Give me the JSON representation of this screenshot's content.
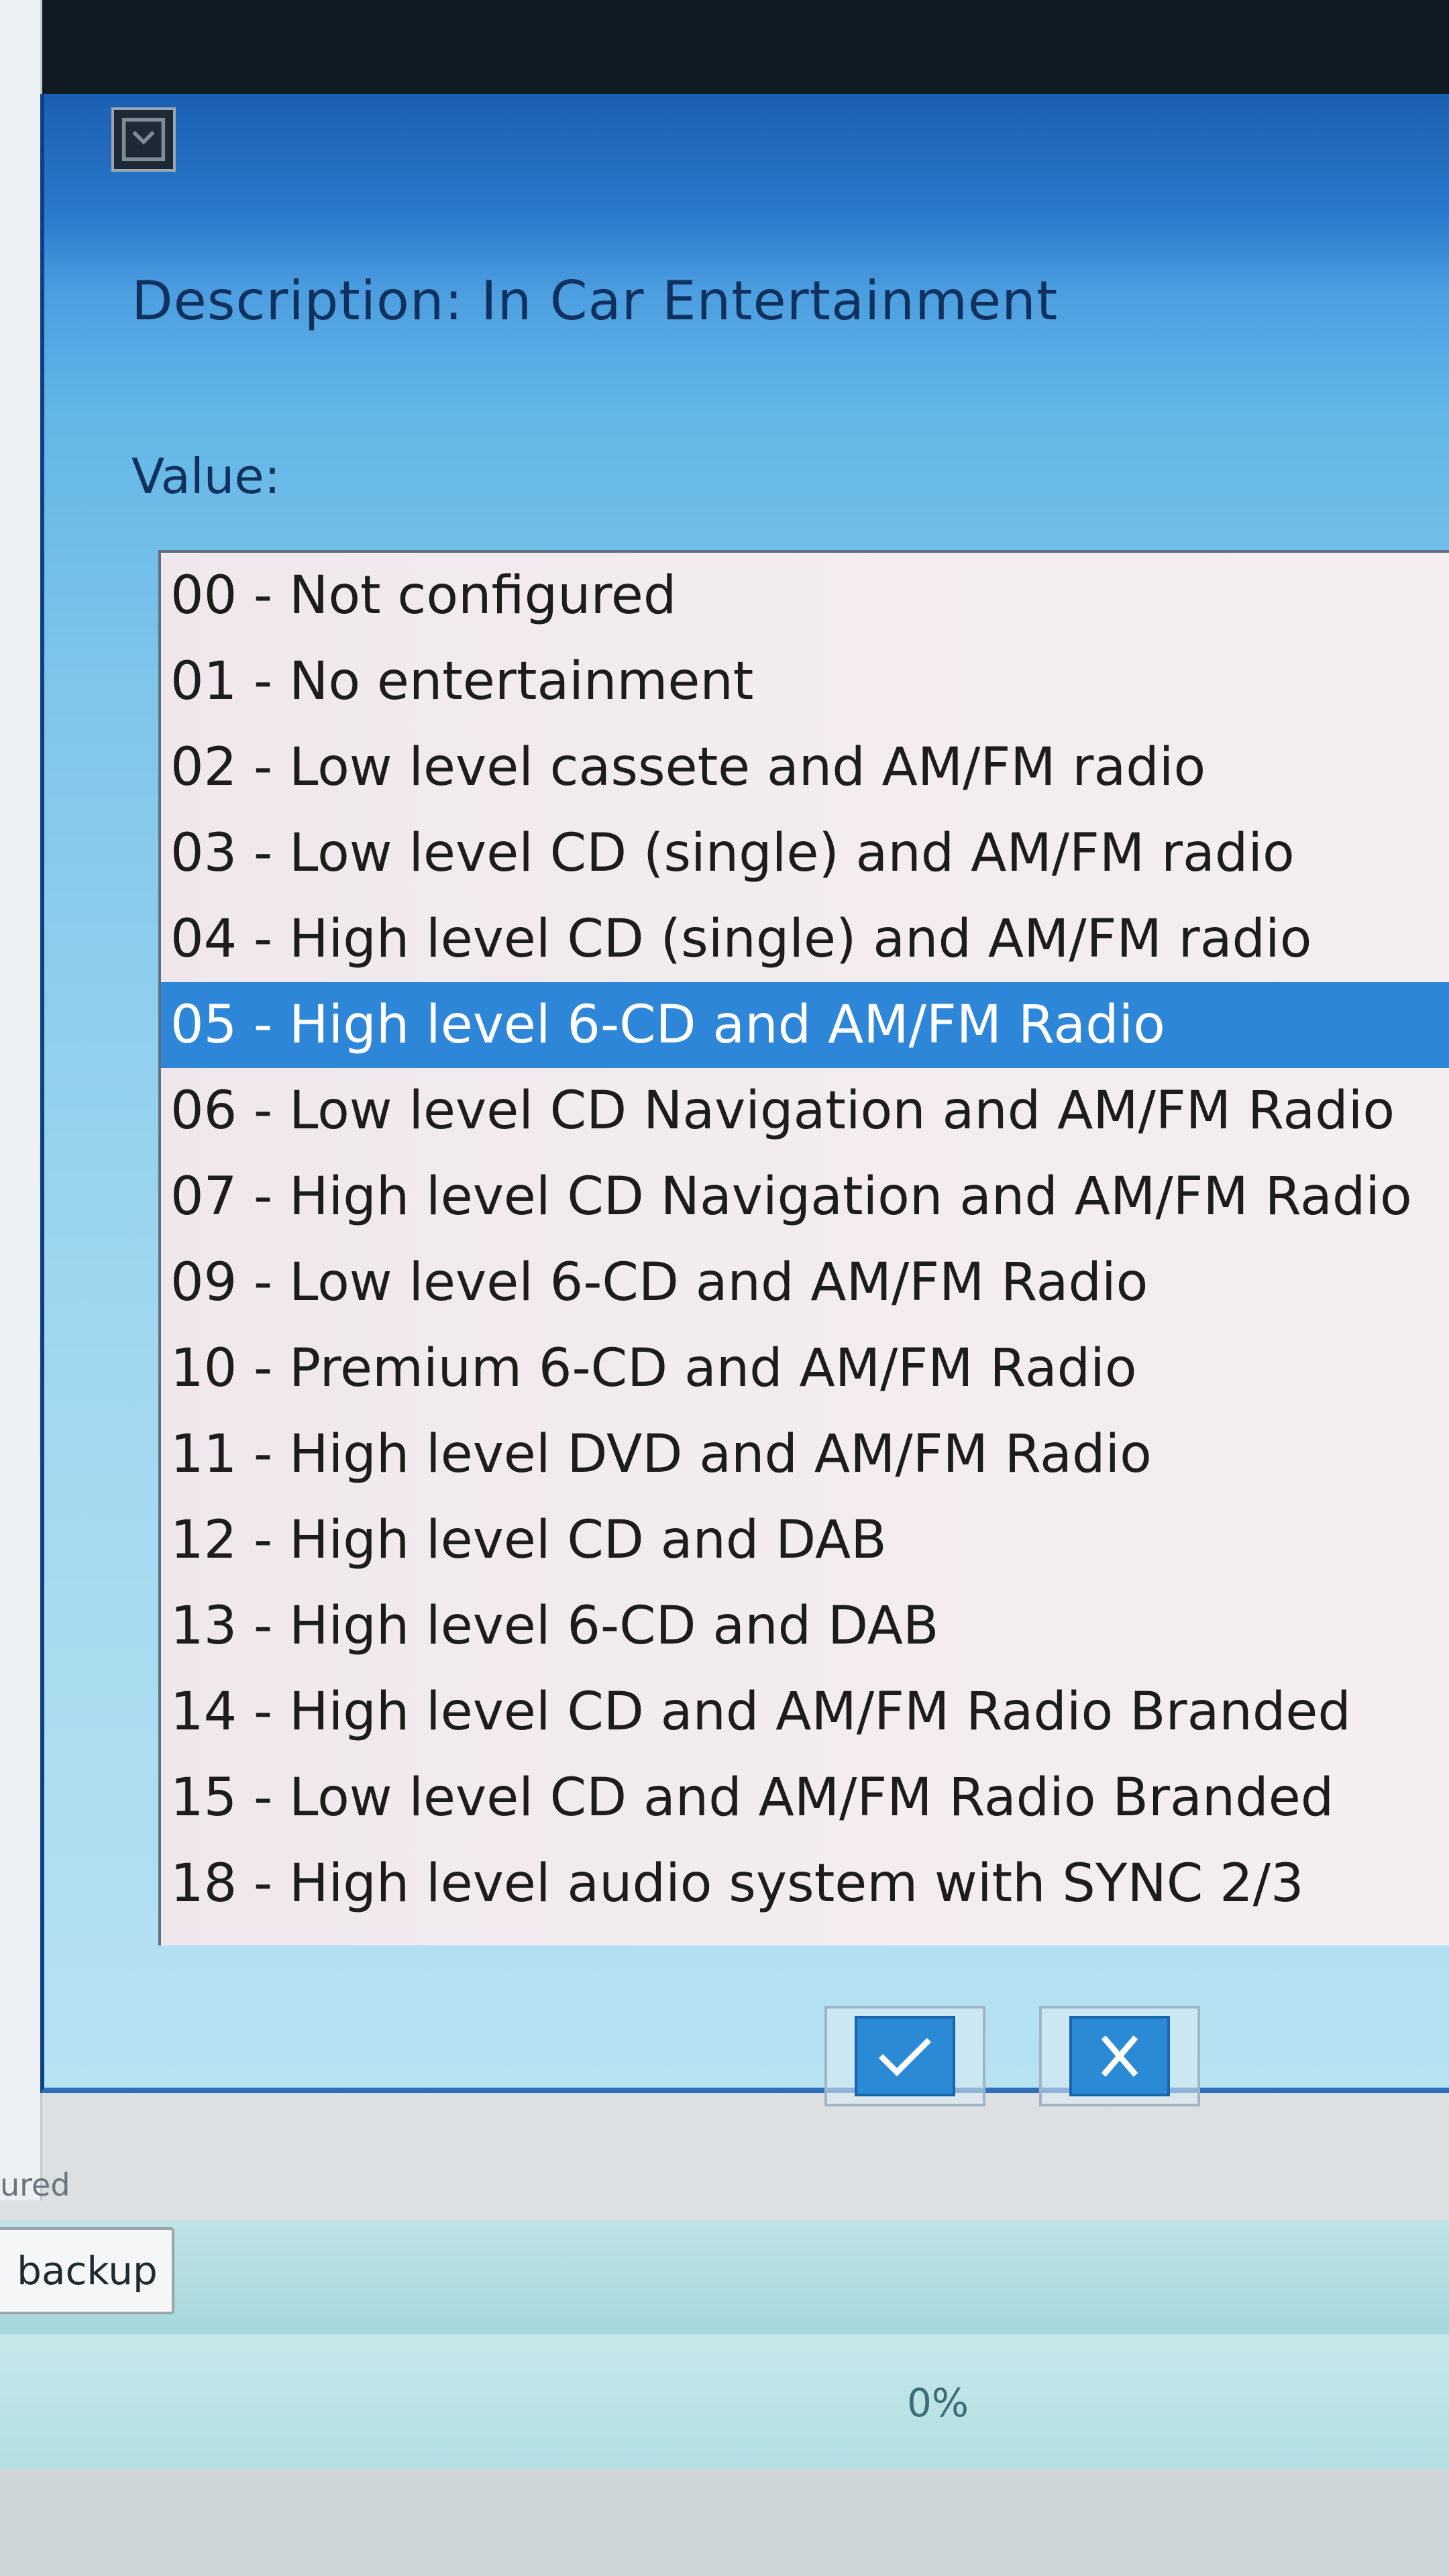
{
  "dialog": {
    "description_label": "Description: In Car Entertainment",
    "value_label": "Value:",
    "selected_index": 5,
    "options": [
      "00 - Not configured",
      "01 - No entertainment",
      "02 - Low level cassete and AM/FM radio",
      "03 - Low level CD (single) and AM/FM radio",
      "04 - High level CD (single) and AM/FM radio",
      "05 - High level 6-CD and AM/FM Radio",
      "06 - Low level CD Navigation and AM/FM Radio",
      "07 - High level CD Navigation and AM/FM Radio",
      "09 - Low level 6-CD and AM/FM Radio",
      "10 - Premium 6-CD and AM/FM Radio",
      "11 - High level DVD and AM/FM Radio",
      "12 - High level CD and DAB",
      "13 - High level 6-CD and DAB",
      "14 - High level CD and AM/FM Radio Branded",
      "15 - Low level CD and AM/FM Radio Branded",
      "18 - High level audio system with SYNC 2/3"
    ],
    "ok_icon": "checkmark-icon",
    "cancel_icon": "close-icon"
  },
  "background": {
    "sublabel": "ured",
    "backup_button_label": "backup",
    "progress_text": "0%"
  },
  "colors": {
    "selection": "#2e86d8",
    "dialog_top": "#1b5fb4",
    "button_blue": "#2a8ad6"
  }
}
